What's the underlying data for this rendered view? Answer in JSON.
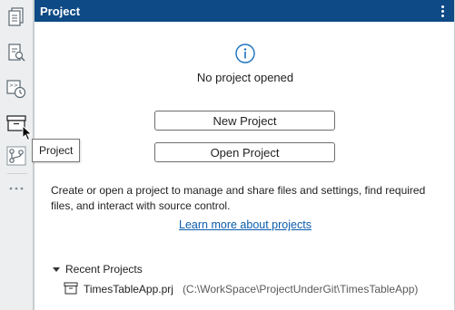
{
  "activity_bar": {
    "items": [
      {
        "icon": "files-icon"
      },
      {
        "icon": "file-search-icon"
      },
      {
        "icon": "command-history-icon"
      },
      {
        "icon": "project-box-icon"
      },
      {
        "icon": "source-control-icon"
      }
    ],
    "more_icon": "ellipsis-icon"
  },
  "tooltip": {
    "text": "Project"
  },
  "panel": {
    "title": "Project",
    "empty_state": {
      "icon": "info-icon",
      "message": "No project opened"
    },
    "buttons": {
      "new_project": "New Project",
      "open_project": "Open Project"
    },
    "description": "Create or open a project to manage and share files and settings, find required files, and interact with source control.",
    "learn_more_link": "Learn more about projects",
    "recent": {
      "header": "Recent Projects",
      "items": [
        {
          "name": "TimesTableApp.prj",
          "path": "(C:\\WorkSpace\\ProjectUnderGit\\TimesTableApp)"
        }
      ]
    }
  },
  "colors": {
    "header_bg": "#0e4a85",
    "accent_icon": "#1a6fbf",
    "link": "#0b5cad",
    "activity_bg": "#eceeef"
  }
}
